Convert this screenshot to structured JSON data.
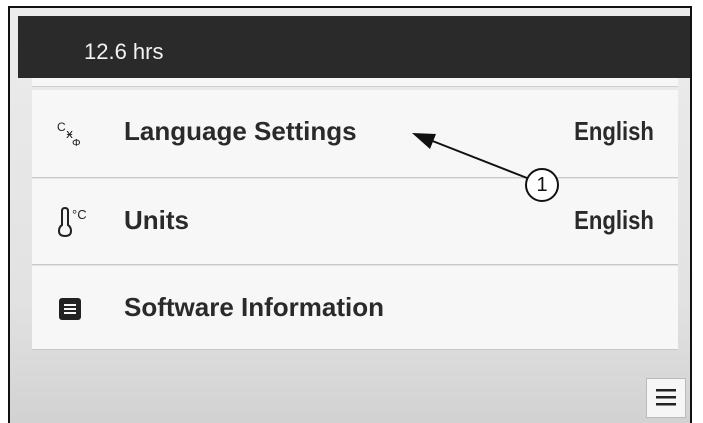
{
  "status": {
    "hours": "12.6 hrs"
  },
  "settings": [
    {
      "label": "Language Settings",
      "value": "English",
      "icon": "language-icon"
    },
    {
      "label": "Units",
      "value": "English",
      "icon": "thermometer-icon"
    },
    {
      "label": "Software Information",
      "value": "",
      "icon": "document-icon"
    }
  ],
  "menu": {
    "icon": "hamburger-menu-icon"
  },
  "callout": {
    "number": "1"
  }
}
